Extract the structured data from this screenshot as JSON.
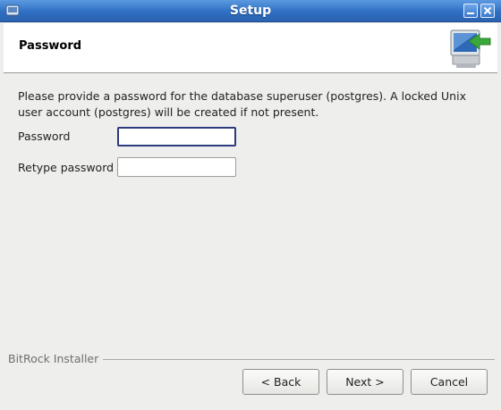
{
  "window": {
    "title": "Setup",
    "app_icon": "app-icon",
    "minimize_icon": "minimize-icon",
    "close_icon": "close-icon"
  },
  "header": {
    "title": "Password",
    "icon": "computer-install-icon"
  },
  "body": {
    "description": "Please provide a password for the database superuser (postgres). A locked Unix user account (postgres) will be created if not present.",
    "password_label": "Password",
    "password_value": "",
    "retype_label": "Retype password",
    "retype_value": ""
  },
  "footer": {
    "brand": "BitRock Installer",
    "back_label": "< Back",
    "next_label": "Next >",
    "cancel_label": "Cancel"
  },
  "colors": {
    "titlebar": "#2f6fc4",
    "focus_border": "#2c3a7e",
    "background": "#eeeeec"
  }
}
